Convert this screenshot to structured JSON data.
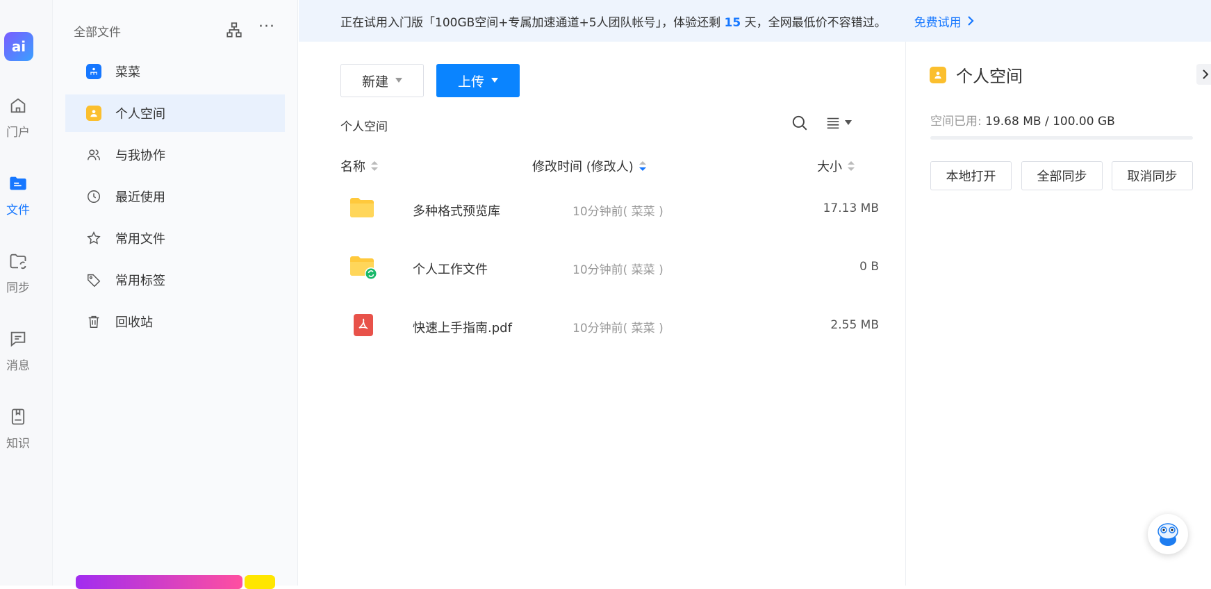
{
  "rail": {
    "logo_text": "ai",
    "items": [
      {
        "label": "门户",
        "icon": "home-icon"
      },
      {
        "label": "文件",
        "icon": "folder-icon",
        "active": true
      },
      {
        "label": "同步",
        "icon": "sync-folder-icon"
      },
      {
        "label": "消息",
        "icon": "message-icon"
      },
      {
        "label": "知识",
        "icon": "knowledge-icon"
      }
    ]
  },
  "sidebar": {
    "header": "全部文件",
    "items": [
      {
        "label": "菜菜",
        "icon": "team-icon"
      },
      {
        "label": "个人空间",
        "icon": "personal-space-icon",
        "active": true
      },
      {
        "label": "与我协作",
        "icon": "users-icon"
      },
      {
        "label": "最近使用",
        "icon": "clock-icon"
      },
      {
        "label": "常用文件",
        "icon": "star-icon"
      },
      {
        "label": "常用标签",
        "icon": "tag-icon"
      },
      {
        "label": "回收站",
        "icon": "trash-icon"
      }
    ]
  },
  "banner": {
    "text_before": "正在试用入门版「100GB空间+专属加速通道+5人团队帐号」，体验还剩 ",
    "days": "15",
    "text_after": " 天，全网最低价不容错过。",
    "cta": "免费试用"
  },
  "toolbar": {
    "new_label": "新建",
    "upload_label": "上传"
  },
  "breadcrumb": "个人空间",
  "table": {
    "columns": {
      "name": "名称",
      "modified": "修改时间 (修改人)",
      "size": "大小"
    },
    "rows": [
      {
        "name": "多种格式预览库",
        "time": "10分钟前( 菜菜 )",
        "size": "17.13 MB",
        "type": "folder"
      },
      {
        "name": "个人工作文件",
        "time": "10分钟前( 菜菜 )",
        "size": "0 B",
        "type": "sync-folder"
      },
      {
        "name": "快速上手指南.pdf",
        "time": "10分钟前( 菜菜 )",
        "size": "2.55 MB",
        "type": "pdf"
      }
    ]
  },
  "panel": {
    "title": "个人空间",
    "usage_label": "空间已用: ",
    "usage_value": "19.68 MB / 100.00 GB",
    "usage_fraction": 0.0002,
    "buttons": [
      "本地打开",
      "全部同步",
      "取消同步"
    ]
  },
  "colors": {
    "accent": "#0a84ff",
    "folder": "#ffc93c",
    "pdf": "#e8524a",
    "personal": "#fbbf2e"
  }
}
